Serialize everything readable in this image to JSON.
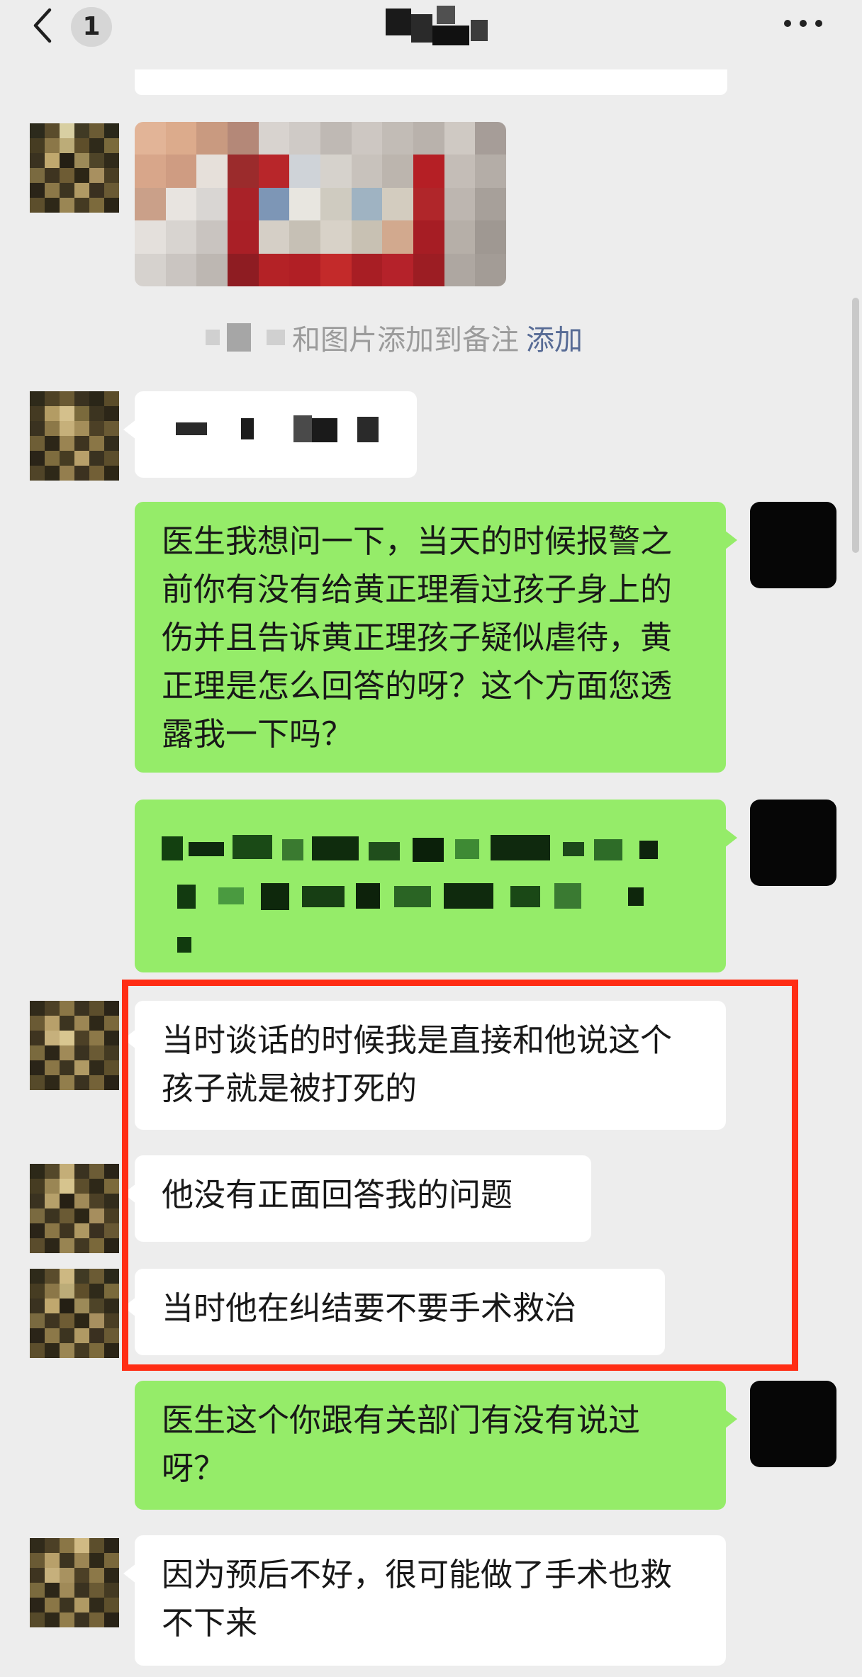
{
  "header": {
    "back_label": "<",
    "unread_count": "1",
    "title_label": "chat-title-redacted",
    "more_label": "..."
  },
  "messages": [
    {
      "id": "m1",
      "from": "contact",
      "kind": "image",
      "content": "pixelated photo"
    },
    {
      "id": "m2",
      "from": "system",
      "kind": "note",
      "text": "和图片添加到备注",
      "link": "添加"
    },
    {
      "id": "m3",
      "from": "contact",
      "kind": "redacted"
    },
    {
      "id": "m4",
      "from": "me",
      "kind": "text",
      "text": "医生我想问一下，当天的时候报警之前你有没有给黄正理看过孩子身上的伤并且告诉黄正理孩子疑似虐待，黄正理是怎么回答的呀？这个方面您透露我一下吗？"
    },
    {
      "id": "m5",
      "from": "me",
      "kind": "redacted"
    },
    {
      "id": "m6",
      "from": "contact",
      "kind": "text",
      "text": "当时谈话的时候我是直接和他说这个孩子就是被打死的",
      "highlighted": true
    },
    {
      "id": "m7",
      "from": "contact",
      "kind": "text",
      "text": "他没有正面回答我的问题",
      "highlighted": true
    },
    {
      "id": "m8",
      "from": "contact",
      "kind": "text",
      "text": "当时他在纠结要不要手术救治",
      "highlighted": true
    },
    {
      "id": "m9",
      "from": "me",
      "kind": "text",
      "text": "医生这个你跟有关部门有没有说过呀？"
    },
    {
      "id": "m10",
      "from": "contact",
      "kind": "text",
      "text": "因为预后不好，很可能做了手术也救不下来"
    }
  ],
  "colors": {
    "background": "#ededed",
    "incoming_bubble": "#ffffff",
    "outgoing_bubble": "#95ec69",
    "link": "#576b95",
    "highlight_frame": "#ff2d14",
    "self_avatar": "#060606"
  }
}
